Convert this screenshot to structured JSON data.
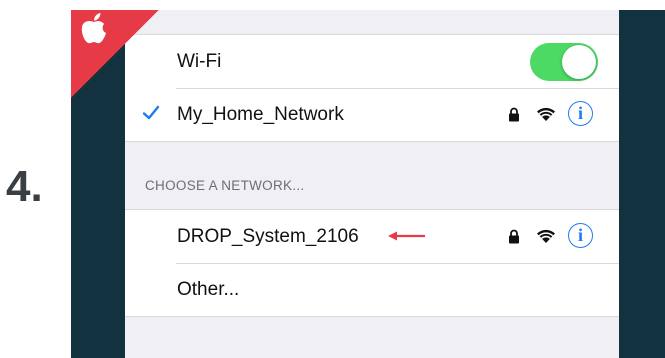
{
  "step": {
    "number": "4."
  },
  "colors": {
    "frame": "#13323f",
    "badge": "#e63a46",
    "toggle_on": "#4cd964",
    "accent_blue": "#1e7cf2",
    "arrow": "#e63a46"
  },
  "settings": {
    "wifi": {
      "label": "Wi-Fi",
      "toggle_state": "on"
    },
    "connected_network": {
      "name": "My_Home_Network",
      "checked": true,
      "icons": [
        "lock-icon",
        "wifi-icon",
        "info-icon"
      ]
    },
    "section_header": "CHOOSE A NETWORK...",
    "networks": [
      {
        "name": "DROP_System_2106",
        "icons": [
          "lock-icon",
          "wifi-icon",
          "info-icon"
        ],
        "highlighted": true
      },
      {
        "name": "Other..."
      }
    ],
    "info_glyph": "i"
  }
}
